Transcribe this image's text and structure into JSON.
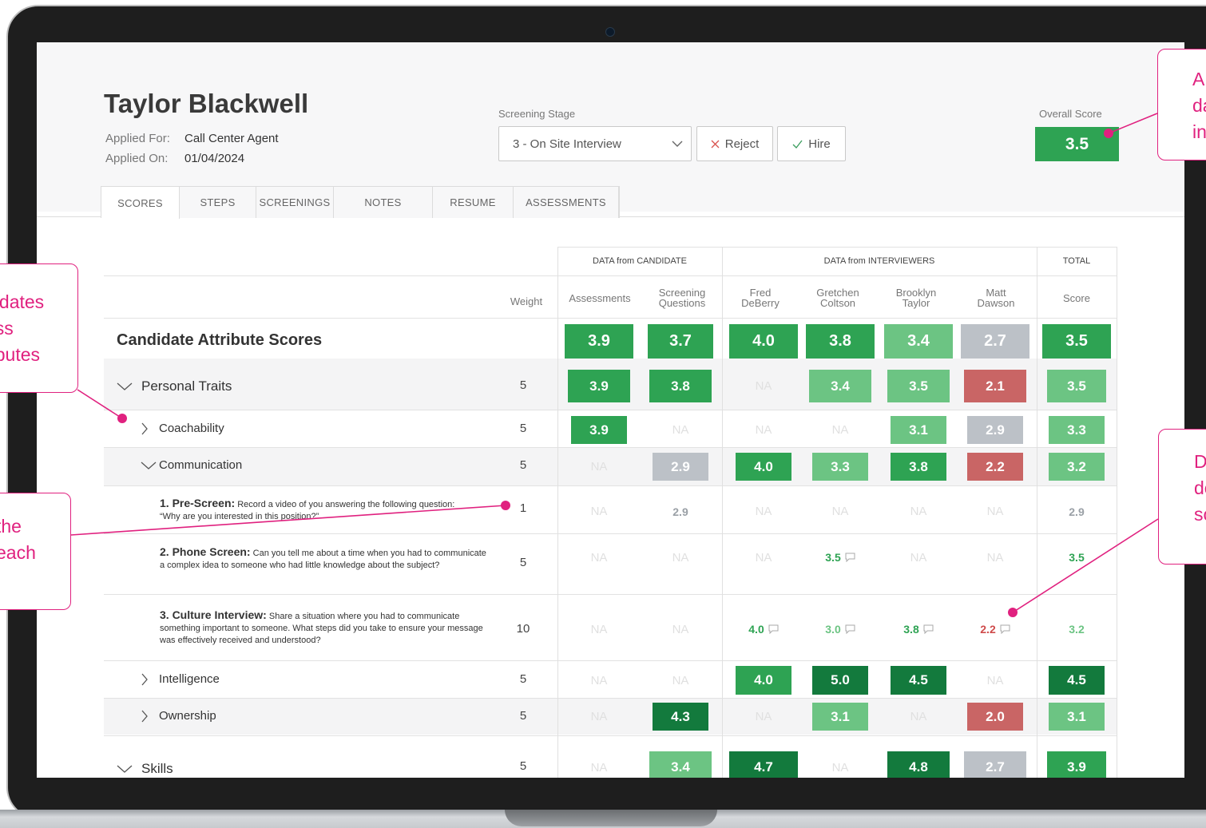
{
  "candidate": {
    "name": "Taylor Blackwell",
    "applied_for_label": "Applied For:",
    "applied_for": "Call Center Agent",
    "applied_on_label": "Applied On:",
    "applied_on": "01/04/2024"
  },
  "screening_stage": {
    "label": "Screening Stage",
    "value": "3 - On Site Interview"
  },
  "actions": {
    "reject": "Reject",
    "hire": "Hire"
  },
  "overall": {
    "label": "Overall Score",
    "value": "3.5"
  },
  "tabs": [
    "SCORES",
    "STEPS",
    "SCREENINGS",
    "NOTES",
    "RESUME",
    "ASSESSMENTS"
  ],
  "active_tab": "SCORES",
  "table": {
    "group_headers": [
      "DATA from CANDIDATE",
      "DATA from INTERVIEWERS",
      "TOTAL"
    ],
    "weight_header": "Weight",
    "columns": [
      "Assessments",
      "Screening\nQuestions",
      "Fred\nDeBerry",
      "Gretchen\nColtson",
      "Brooklyn\nTaylor",
      "Matt\nDawson",
      "Score"
    ],
    "summary": {
      "label": "Candidate Attribute Scores",
      "cells": [
        [
          "3.9",
          "green"
        ],
        [
          "3.7",
          "green"
        ],
        [
          "4.0",
          "green"
        ],
        [
          "3.8",
          "green"
        ],
        [
          "3.4",
          "light"
        ],
        [
          "2.7",
          "gray"
        ],
        [
          "3.5",
          "green"
        ]
      ]
    },
    "rows": [
      {
        "label": "Personal Traits",
        "level": 0,
        "expander": "down",
        "weight": "5",
        "cells": [
          [
            "3.9",
            "green"
          ],
          [
            "3.8",
            "green"
          ],
          [
            "NA",
            "na"
          ],
          [
            "3.4",
            "light"
          ],
          [
            "3.5",
            "light"
          ],
          [
            "2.1",
            "red"
          ],
          [
            "3.5",
            "light"
          ]
        ]
      },
      {
        "label": "Coachability",
        "level": 1,
        "expander": "right",
        "weight": "5",
        "cells": [
          [
            "3.9",
            "green"
          ],
          [
            "NA",
            "na"
          ],
          [
            "NA",
            "na"
          ],
          [
            "NA",
            "na"
          ],
          [
            "3.1",
            "light"
          ],
          [
            "2.9",
            "gray"
          ],
          [
            "3.3",
            "light"
          ]
        ]
      },
      {
        "label": "Communication",
        "level": 1,
        "expander": "down",
        "weight": "5",
        "cells": [
          [
            "NA",
            "na"
          ],
          [
            "2.9",
            "gray"
          ],
          [
            "4.0",
            "green"
          ],
          [
            "3.3",
            "light"
          ],
          [
            "3.8",
            "green"
          ],
          [
            "2.2",
            "red"
          ],
          [
            "3.2",
            "light"
          ]
        ]
      },
      {
        "question_title": "1. Pre-Screen:",
        "question_text": "Record a video of you answering the following question: “Why are you interested in this position?”",
        "weight": "1",
        "cells": [
          [
            "NA",
            "na"
          ],
          [
            "2.9",
            "t-gray"
          ],
          [
            "NA",
            "na"
          ],
          [
            "NA",
            "na"
          ],
          [
            "NA",
            "na"
          ],
          [
            "NA",
            "na"
          ],
          [
            "2.9",
            "t-gray"
          ]
        ]
      },
      {
        "question_title": "2. Phone Screen:",
        "question_text": "Can you tell me about a time when you had to communicate a complex idea to someone who had little knowledge about the subject?",
        "weight": "5",
        "cells": [
          [
            "NA",
            "na"
          ],
          [
            "NA",
            "na"
          ],
          [
            "NA",
            "na"
          ],
          [
            "3.5",
            "t-green-c"
          ],
          [
            "NA",
            "na"
          ],
          [
            "NA",
            "na"
          ],
          [
            "3.5",
            "t-green"
          ]
        ]
      },
      {
        "question_title": "3. Culture Interview:",
        "question_text": "Share a situation where you had to communicate something important to someone. What steps did you take to ensure your message was effectively received and understood?",
        "weight": "10",
        "cells": [
          [
            "NA",
            "na"
          ],
          [
            "NA",
            "na"
          ],
          [
            "4.0",
            "t-green-c"
          ],
          [
            "3.0",
            "t-light-c"
          ],
          [
            "3.8",
            "t-green-c"
          ],
          [
            "2.2",
            "t-red-c"
          ],
          [
            "3.2",
            "t-light"
          ]
        ]
      },
      {
        "label": "Intelligence",
        "level": 1,
        "expander": "right",
        "weight": "5",
        "cells": [
          [
            "NA",
            "na"
          ],
          [
            "NA",
            "na"
          ],
          [
            "4.0",
            "green"
          ],
          [
            "5.0",
            "dark"
          ],
          [
            "4.5",
            "dark"
          ],
          [
            "NA",
            "na"
          ],
          [
            "4.5",
            "dark"
          ]
        ]
      },
      {
        "label": "Ownership",
        "level": 1,
        "expander": "right",
        "weight": "5",
        "cells": [
          [
            "NA",
            "na"
          ],
          [
            "4.3",
            "dark"
          ],
          [
            "NA",
            "na"
          ],
          [
            "3.1",
            "light"
          ],
          [
            "NA",
            "na"
          ],
          [
            "2.0",
            "red"
          ],
          [
            "3.1",
            "light"
          ]
        ]
      },
      {
        "label": "Skills",
        "level": 0,
        "expander": "down",
        "weight": "5",
        "cells": [
          [
            "NA",
            "na"
          ],
          [
            "3.4",
            "light"
          ],
          [
            "4.7",
            "dark"
          ],
          [
            "NA",
            "na"
          ],
          [
            "4.8",
            "dark"
          ],
          [
            "2.7",
            "gray"
          ],
          [
            "3.9",
            "green"
          ]
        ]
      }
    ]
  },
  "colors": {
    "green": "#2ea353",
    "light": "#6cc483",
    "dark": "#137a3d",
    "gray": "#bcc1c7",
    "red": "#c96565",
    "text_green": "#2ea353",
    "text_light": "#6cc483",
    "text_gray": "#9aa0a6",
    "text_red": "#cf4b4b",
    "callout": "#e0217f"
  },
  "callouts": [
    {
      "lines": [
        "A",
        "da",
        "int"
      ]
    },
    {
      "lines": [
        "didates",
        "oss",
        "ributes"
      ]
    },
    {
      "lines": [
        "the",
        "each"
      ]
    },
    {
      "lines": [
        "D",
        "de",
        "sc"
      ]
    }
  ]
}
